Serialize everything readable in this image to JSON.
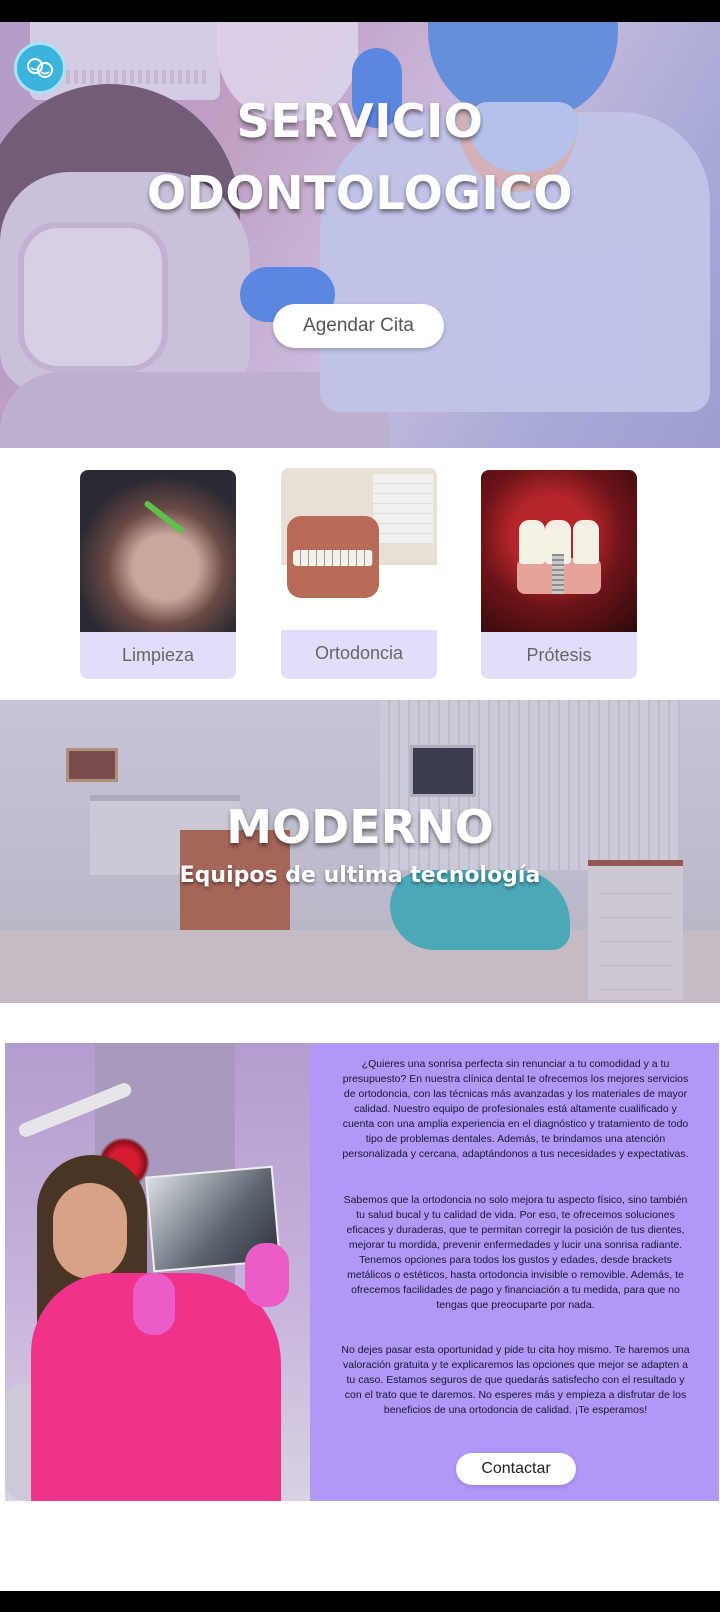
{
  "hero": {
    "title_line1": "SERVICIO",
    "title_line2": "ODONTOLOGICO",
    "cta_label": "Agendar Cita"
  },
  "logo": {
    "icon": "smile-icon",
    "color": "#3bb3dd"
  },
  "services": [
    {
      "label": "Limpieza"
    },
    {
      "label": "Ortodoncia"
    },
    {
      "label": "Prótesis"
    }
  ],
  "moderno": {
    "title": "MODERNO",
    "subtitle": "Equipos de ultima tecnología"
  },
  "info": {
    "paragraph1": "¿Quieres una sonrisa perfecta sin renunciar a tu comodidad y a tu presupuesto? En nuestra clínica dental te ofrecemos los mejores servicios de ortodoncia, con las técnicas más avanzadas y los materiales de mayor calidad. Nuestro equipo de profesionales está altamente cualificado y cuenta con una amplia experiencia en el diagnóstico y tratamiento de todo tipo de problemas dentales. Además, te brindamos una atención personalizada y cercana, adaptándonos a tus necesidades y expectativas.",
    "paragraph2": "Sabemos que la ortodoncia no solo mejora tu aspecto físico, sino también tu salud bucal y tu calidad de vida. Por eso, te ofrecemos soluciones eficaces y duraderas, que te permitan corregir la posición de tus dientes, mejorar tu mordida, prevenir enfermedades y lucir una sonrisa radiante. Tenemos opciones para todos los gustos y edades, desde brackets metálicos o estéticos, hasta ortodoncia invisible o removible. Además, te ofrecemos facilidades de pago y financiación a tu medida, para que no tengas que preocuparte por nada.",
    "paragraph3": "No dejes pasar esta oportunidad y pide tu cita hoy mismo. Te haremos una valoración gratuita y te explicaremos las opciones que mejor se adapten a tu caso. Estamos seguros de que quedarás satisfecho con el resultado y con el trato que te daremos. No esperes más y empieza a disfrutar de los beneficios de una ortodoncia de calidad. ¡Te esperamos!",
    "cta_label": "Contactar"
  },
  "colors": {
    "card_bg": "#e3dcfb",
    "info_bg": "#af98f6"
  }
}
